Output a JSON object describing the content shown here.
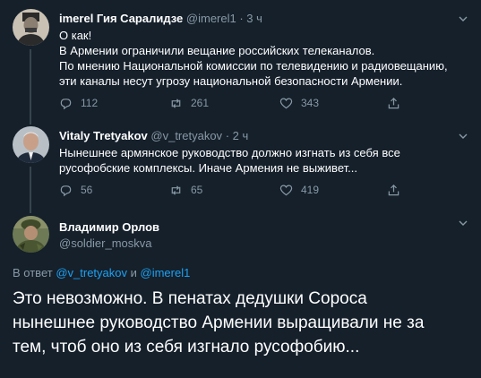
{
  "tweets": [
    {
      "name": "imerel Гия Саралидзе",
      "handle": "@imerel1",
      "time": "· 3 ч",
      "lines": [
        "О как!",
        "В Армении ограничили вещание российских телеканалов.",
        "По мнению Национальной комиссии по телевидению и радиовещанию,",
        "эти каналы несут угрозу национальной безопасности Армении."
      ],
      "replies": "112",
      "retweets": "261",
      "likes": "343"
    },
    {
      "name": "Vitaly Tretyakov",
      "handle": "@v_tretyakov",
      "time": "· 2 ч",
      "lines": [
        "Нынешнее армянское руководство должно изгнать из себя все",
        "русофобские комплексы. Иначе Армения не выживет..."
      ],
      "replies": "56",
      "retweets": "65",
      "likes": "419"
    }
  ],
  "main_tweet": {
    "name": "Владимир Орлов",
    "handle": "@soldier_moskva",
    "reply_prefix": "В ответ",
    "reply_user1": "@v_tretyakov",
    "reply_and": "и",
    "reply_user2": "@imerel1",
    "lines": [
      "Это невозможно. В пенатах дедушки Сороса",
      "нынешнее руководство Армении выращивали не за",
      "тем, чтоб оно из себя изгнало русофобию..."
    ]
  },
  "icons": {
    "reply": "reply-icon",
    "retweet": "retweet-icon",
    "like": "heart-icon",
    "share": "share-icon",
    "more": "chevron-down-icon"
  },
  "colors": {
    "background": "#15202b",
    "secondary_text": "#8899a6",
    "link": "#1da1f2",
    "divider": "#38444d"
  }
}
